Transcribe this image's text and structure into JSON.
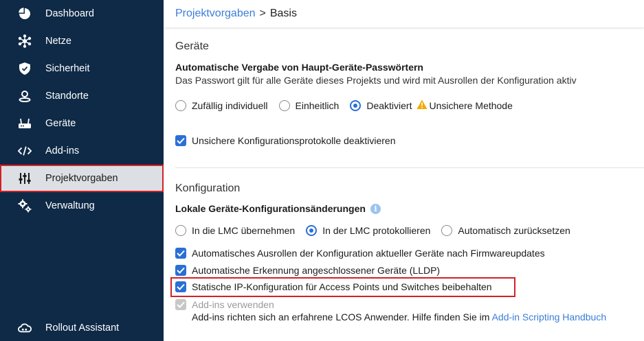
{
  "sidebar": {
    "items": [
      {
        "label": "Dashboard",
        "icon": "dashboard-pie-icon"
      },
      {
        "label": "Netze",
        "icon": "network-icon"
      },
      {
        "label": "Sicherheit",
        "icon": "shield-icon"
      },
      {
        "label": "Standorte",
        "icon": "location-icon"
      },
      {
        "label": "Geräte",
        "icon": "router-icon"
      },
      {
        "label": "Add-ins",
        "icon": "code-icon"
      },
      {
        "label": "Projektvorgaben",
        "icon": "sliders-icon",
        "active": true
      },
      {
        "label": "Verwaltung",
        "icon": "gears-icon"
      }
    ],
    "bottom": {
      "label": "Rollout Assistant",
      "icon": "cloud-icon"
    }
  },
  "breadcrumb": {
    "parent": "Projektvorgaben",
    "separator": ">",
    "current": "Basis"
  },
  "devices": {
    "title": "Geräte",
    "password_heading": "Automatische Vergabe von Haupt-Geräte-Passwörtern",
    "password_desc": "Das Passwort gilt für alle Geräte dieses Projekts und wird mit Ausrollen der Konfiguration aktiv",
    "password_options": [
      "Zufällig individuell",
      "Einheitlich",
      "Deaktiviert"
    ],
    "password_selected": "Deaktiviert",
    "warning": "Unsichere Methode",
    "insecure_protocols": "Unsichere Konfigurationsprotokolle deaktivieren"
  },
  "config": {
    "title": "Konfiguration",
    "local_heading": "Lokale Geräte-Konfigurationsänderungen",
    "local_options": [
      "In die LMC übernehmen",
      "In der LMC protokollieren",
      "Automatisch zurücksetzen"
    ],
    "local_selected": "In der LMC protokollieren",
    "auto_rollout": "Automatisches Ausrollen der Konfiguration aktueller Geräte nach Firmwareupdates",
    "lldp": "Automatische Erkennung angeschlossener Geräte (LLDP)",
    "static_ip": "Statische IP-Konfiguration für Access Points und Switches beibehalten",
    "addins": "Add-ins verwenden",
    "addins_hint": "Add-ins richten sich an erfahrene LCOS Anwender. Hilfe finden Sie im",
    "addins_link": "Add-in Scripting Handbuch"
  },
  "colors": {
    "sidebar_bg": "#0e2a47",
    "accent": "#2a6fd6",
    "highlight": "#d32027",
    "link": "#3b7dd8",
    "warning": "#f2a900"
  }
}
